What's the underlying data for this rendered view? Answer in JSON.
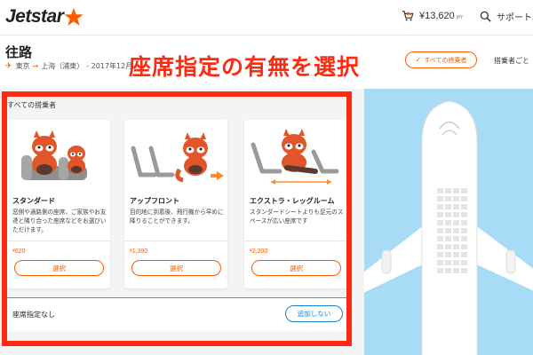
{
  "header": {
    "logo_text": "Jetstar",
    "cart_amount": "¥13,620",
    "cart_currency": "JPY",
    "support_label": "サポート"
  },
  "route": {
    "title": "往路",
    "origin": "東京",
    "destination": "上海（浦東）",
    "date_text": "- 2017年12月",
    "all_passengers_button": "すべての搭乗者",
    "per_passenger_label": "搭乗者ごと"
  },
  "banner": {
    "text": "座席指定の有無を選択"
  },
  "seat_section": {
    "label": "すべての搭乗者",
    "cards": [
      {
        "title": "スタンダード",
        "description": "窓側や通路側の座席、ご家族やお友達と隣り合った座席などをお選びいただけます。",
        "price_symbol": "¥",
        "price": "620",
        "button": "選択"
      },
      {
        "title": "アップフロント",
        "description": "目的地に到着後、飛行機から早めに降りることができます。",
        "price_symbol": "¥",
        "price": "1,390",
        "button": "選択"
      },
      {
        "title": "エクストラ・レッグルーム",
        "description": "スタンダードシートよりも足元のスペースが広い座席です",
        "price_symbol": "¥",
        "price": "2,200",
        "button": "選択"
      }
    ],
    "no_seat": {
      "label": "座席指定なし",
      "button": "追加しない"
    }
  },
  "colors": {
    "brand_orange": "#ff5a00",
    "highlight_red": "#ff2a12",
    "link_blue": "#1a7fd0",
    "sky_blue": "#a8dbf5"
  }
}
